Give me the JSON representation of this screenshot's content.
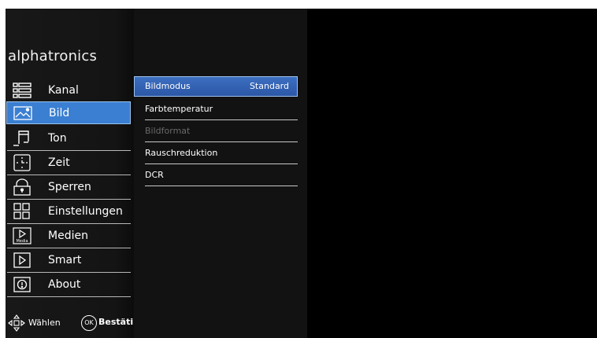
{
  "brand": "alphatronics",
  "menu": [
    {
      "label": "Kanal",
      "icon": "channel-list-icon"
    },
    {
      "label": "Bild",
      "icon": "picture-icon",
      "active": true
    },
    {
      "label": "Ton",
      "icon": "music-note-icon"
    },
    {
      "label": "Zeit",
      "icon": "clock-icon"
    },
    {
      "label": "Sperren",
      "icon": "lock-icon"
    },
    {
      "label": "Einstellungen",
      "icon": "settings-grid-icon"
    },
    {
      "label": "Medien",
      "icon": "media-icon",
      "icon_text": "Media"
    },
    {
      "label": "Smart",
      "icon": "play-icon"
    },
    {
      "label": "About",
      "icon": "info-icon"
    }
  ],
  "submenu": [
    {
      "label": "Bildmodus",
      "value": "Standard",
      "active": true
    },
    {
      "label": "Farbtemperatur"
    },
    {
      "label": "Bildformat",
      "disabled": true
    },
    {
      "label": "Rauschreduktion"
    },
    {
      "label": "DCR"
    }
  ],
  "footer": {
    "navigate_label": "Wählen",
    "ok_icon_text": "OK",
    "confirm_label": "Bestäti"
  },
  "colors": {
    "accent": "#3a7fd2",
    "background": "#000000",
    "disabled_text": "#6a6a6a"
  }
}
